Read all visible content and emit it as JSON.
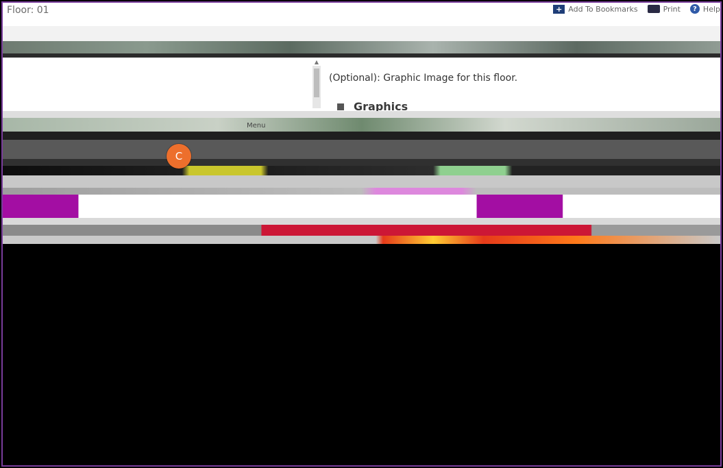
{
  "window": {
    "title": "Floor: 01"
  },
  "toolbar": {
    "bookmarks_label": "Add To Bookmarks",
    "print_label": "Print",
    "help_label": "Help"
  },
  "panel": {
    "optional_text": "(Optional): Graphic Image for this floor.",
    "section_title": "Graphics"
  },
  "menu": {
    "label": "Menu"
  },
  "marker": {
    "letter": "C"
  },
  "colors": {
    "frame_border": "#7a3d9c",
    "marker": "#ed6f2c",
    "accent_magenta": "#a30ea3",
    "accent_red": "#cc1736"
  }
}
